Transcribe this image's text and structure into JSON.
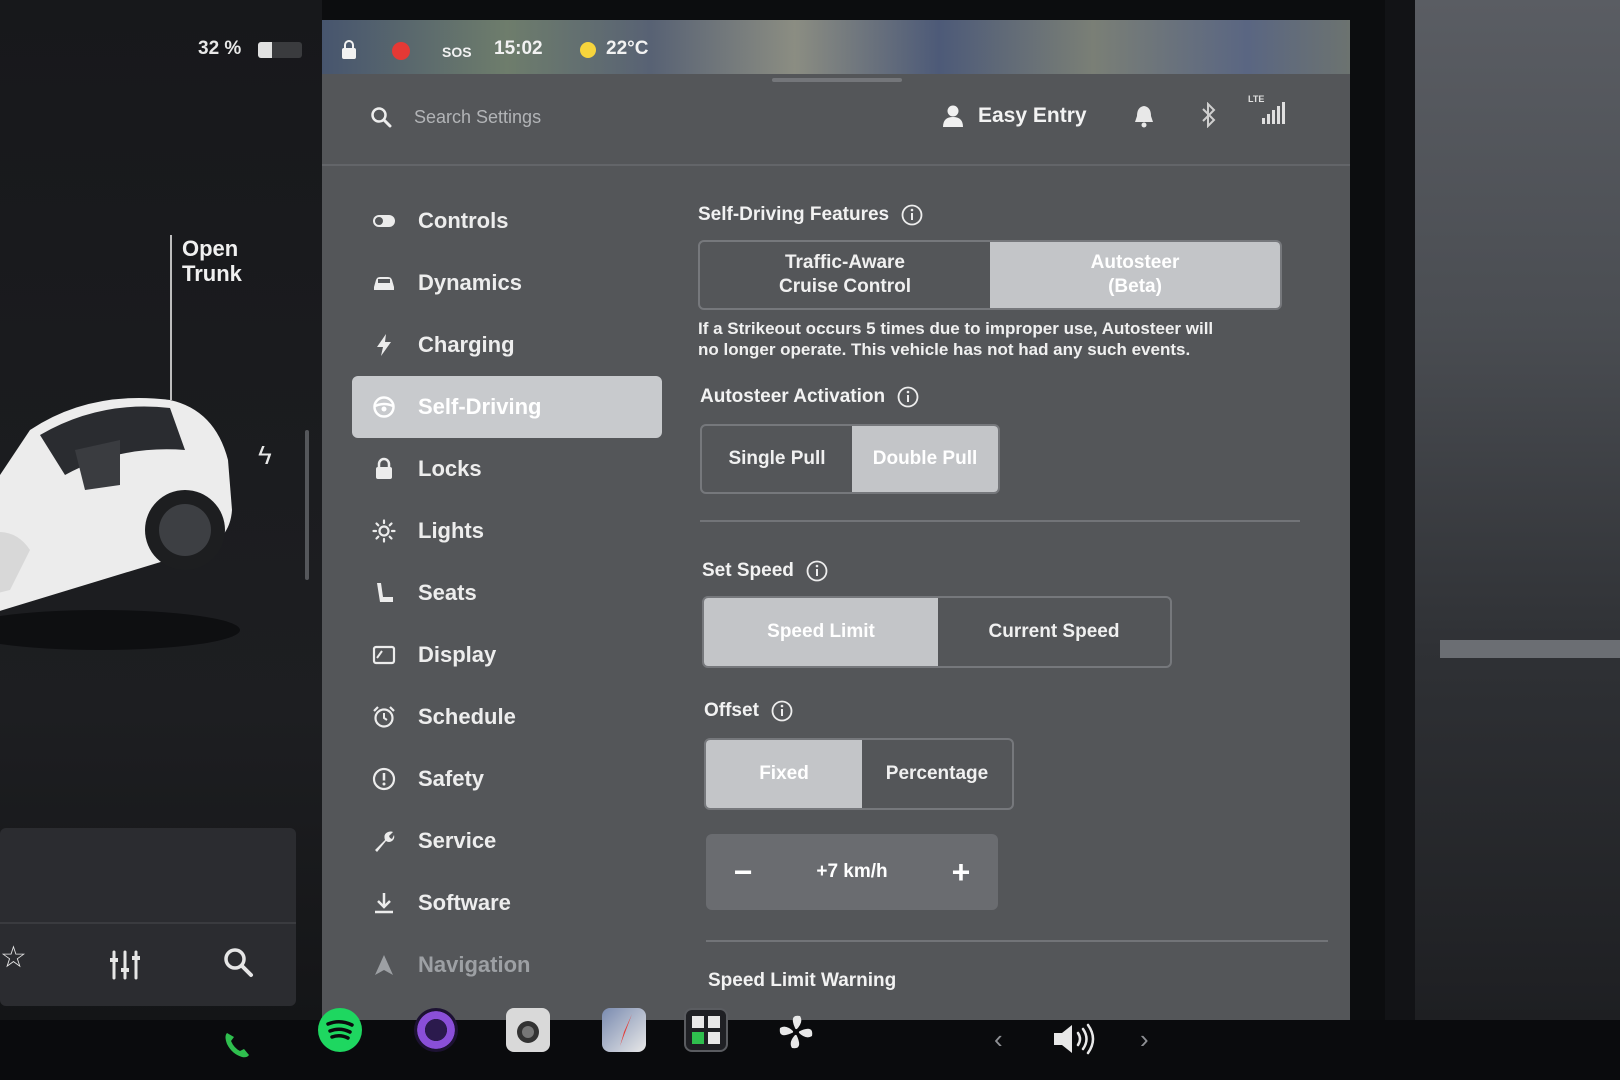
{
  "status_bar": {
    "battery_percent": "32 %",
    "battery_level": 0.32,
    "sos": "SOS",
    "time": "15:02",
    "temperature": "22°C"
  },
  "car_pane": {
    "open_trunk_line1": "Open",
    "open_trunk_line2": "Trunk"
  },
  "top_bar": {
    "search_placeholder": "Search Settings",
    "profile_name": "Easy Entry",
    "network_label": "LTE"
  },
  "nav": {
    "items": [
      {
        "label": "Controls",
        "icon": "toggle-icon"
      },
      {
        "label": "Dynamics",
        "icon": "car-icon"
      },
      {
        "label": "Charging",
        "icon": "bolt-icon"
      },
      {
        "label": "Self-Driving",
        "icon": "steering-wheel-icon",
        "active": true
      },
      {
        "label": "Locks",
        "icon": "lock-icon"
      },
      {
        "label": "Lights",
        "icon": "sun-icon"
      },
      {
        "label": "Seats",
        "icon": "seat-icon"
      },
      {
        "label": "Display",
        "icon": "display-icon"
      },
      {
        "label": "Schedule",
        "icon": "alarm-clock-icon"
      },
      {
        "label": "Safety",
        "icon": "alert-circle-icon"
      },
      {
        "label": "Service",
        "icon": "wrench-icon"
      },
      {
        "label": "Software",
        "icon": "download-icon"
      },
      {
        "label": "Navigation",
        "icon": "navigation-arrow-icon"
      }
    ]
  },
  "self_driving": {
    "features": {
      "title": "Self-Driving Features",
      "option_a_line1": "Traffic-Aware",
      "option_a_line2": "Cruise Control",
      "option_b_line1": "Autosteer",
      "option_b_line2": "(Beta)",
      "selected": "Autosteer (Beta)",
      "note_line1": "If a Strikeout occurs 5 times due to improper use, Autosteer will",
      "note_line2": "no longer operate. This vehicle has not had any such events."
    },
    "activation": {
      "title": "Autosteer Activation",
      "options": [
        "Single Pull",
        "Double Pull"
      ],
      "selected": "Double Pull"
    },
    "set_speed": {
      "title": "Set Speed",
      "options": [
        "Speed Limit",
        "Current Speed"
      ],
      "selected": "Speed Limit"
    },
    "offset": {
      "title": "Offset",
      "options": [
        "Fixed",
        "Percentage"
      ],
      "selected": "Fixed",
      "minus": "−",
      "value": "+7 km/h",
      "plus": "+"
    },
    "speed_limit_warning": {
      "title": "Speed Limit Warning"
    }
  },
  "colors": {
    "display_bg": "#545659",
    "selected_option": "#c3c5c8",
    "recording": "#e53935",
    "spotify_green": "#1ed760"
  }
}
